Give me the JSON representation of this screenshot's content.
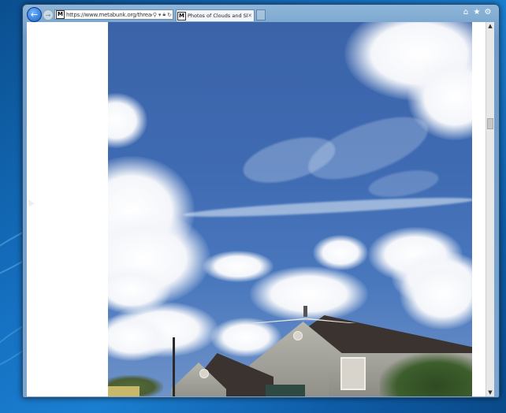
{
  "browser": {
    "address": {
      "url": "https://www.metabunk.org/threads/ph",
      "favicon_letter": "M"
    },
    "tab": {
      "title": "Photos of Clouds and Skies ...",
      "favicon_letter": "M"
    },
    "icons": [
      "back-arrow-icon",
      "forward-arrow-icon",
      "search-icon",
      "dropdown-icon",
      "lock-icon",
      "refresh-icon",
      "close-icon",
      "home-icon",
      "star-icon",
      "gear-icon"
    ]
  },
  "colors": {
    "desktop": "#1671c2",
    "sky": "#3f6bb3",
    "chrome": "#7aa6cf"
  }
}
